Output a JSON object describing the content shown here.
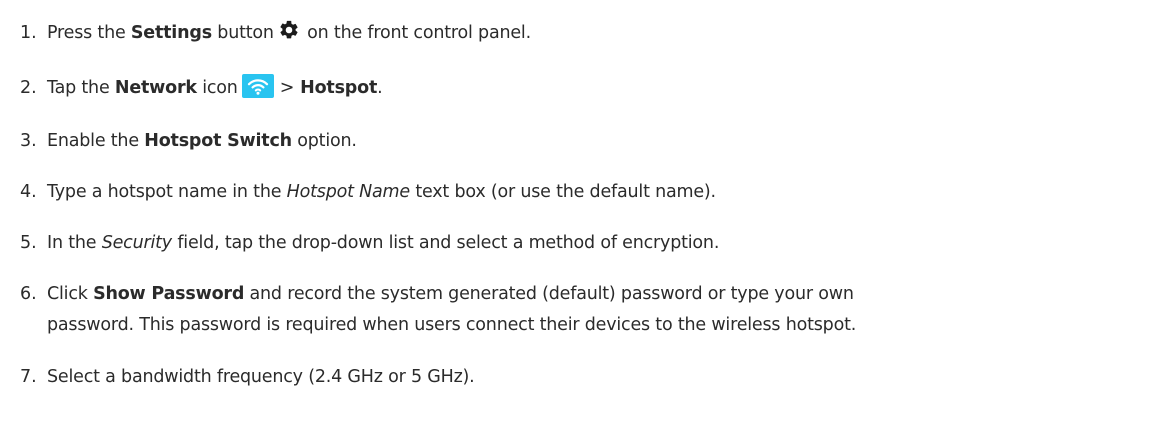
{
  "accent": "#29c4f0",
  "steps": [
    {
      "num": "1.",
      "pre": "Press the ",
      "bold": "Settings",
      "mid": " button",
      "icon": "gear-icon",
      "post": " on the front control panel."
    },
    {
      "num": "2.",
      "pre": "Tap the ",
      "bold": "Network",
      "mid": " icon",
      "icon": "wifi-icon",
      "chevron": ">",
      "bold2": "Hotspot",
      "post": "."
    },
    {
      "num": "3.",
      "pre": "Enable the ",
      "bold": "Hotspot Switch",
      "post": " option."
    },
    {
      "num": "4.",
      "pre": "Type a hotspot name in the ",
      "italic": "Hotspot Name",
      "post": " text box (or use the default name)."
    },
    {
      "num": "5.",
      "pre": "In the ",
      "italic": "Security",
      "post": " field, tap the drop-down list and select a method of encryption."
    },
    {
      "num": "6.",
      "pre": "Click ",
      "bold": "Show Password",
      "post": " and record the system generated (default) password or type your own",
      "line2": "password. This password is required when users connect their devices to the wireless hotspot."
    },
    {
      "num": "7.",
      "text": "Select a bandwidth frequency (2.4 GHz or 5 GHz)."
    }
  ]
}
